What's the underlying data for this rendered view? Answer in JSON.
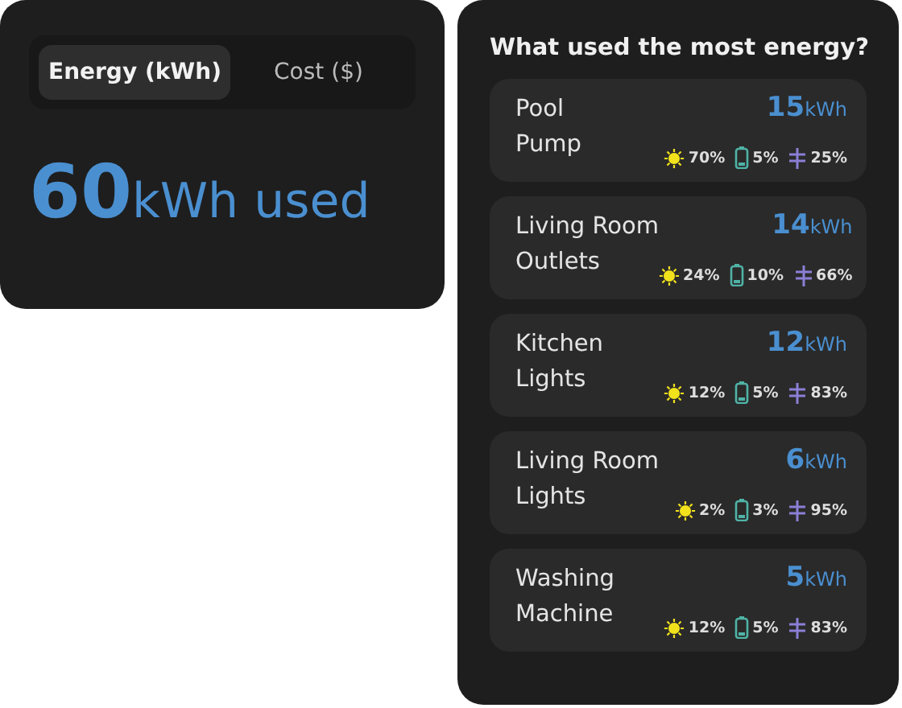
{
  "summary": {
    "tabs": [
      {
        "label": "Energy (kWh)",
        "selected": true
      },
      {
        "label": "Cost ($)",
        "selected": false
      }
    ],
    "value": "60",
    "unit": "kWh used"
  },
  "usage": {
    "title": "What used the most energy?",
    "devices": [
      {
        "name_lines": [
          "Pool",
          "Pump"
        ],
        "amount": "15",
        "unit": "kWh",
        "sources": [
          {
            "kind": "solar",
            "share": "70%"
          },
          {
            "kind": "battery",
            "share": "5%"
          },
          {
            "kind": "grid",
            "share": "25%"
          }
        ]
      },
      {
        "name_lines": [
          "Living Room",
          "Outlets"
        ],
        "amount": "14",
        "unit": "kWh",
        "sources": [
          {
            "kind": "solar",
            "share": "24%"
          },
          {
            "kind": "battery",
            "share": "10%"
          },
          {
            "kind": "grid",
            "share": "66%"
          }
        ]
      },
      {
        "name_lines": [
          "Kitchen",
          "Lights"
        ],
        "amount": "12",
        "unit": "kWh",
        "sources": [
          {
            "kind": "solar",
            "share": "12%"
          },
          {
            "kind": "battery",
            "share": "5%"
          },
          {
            "kind": "grid",
            "share": "83%"
          }
        ]
      },
      {
        "name_lines": [
          "Living Room",
          "Lights"
        ],
        "amount": "6",
        "unit": "kWh",
        "sources": [
          {
            "kind": "solar",
            "share": "2%"
          },
          {
            "kind": "battery",
            "share": "3%"
          },
          {
            "kind": "grid",
            "share": "95%"
          }
        ]
      },
      {
        "name_lines": [
          "Washing",
          "Machine"
        ],
        "amount": "5",
        "unit": "kWh",
        "sources": [
          {
            "kind": "solar",
            "share": "12%"
          },
          {
            "kind": "battery",
            "share": "5%"
          },
          {
            "kind": "grid",
            "share": "83%"
          }
        ]
      }
    ]
  }
}
